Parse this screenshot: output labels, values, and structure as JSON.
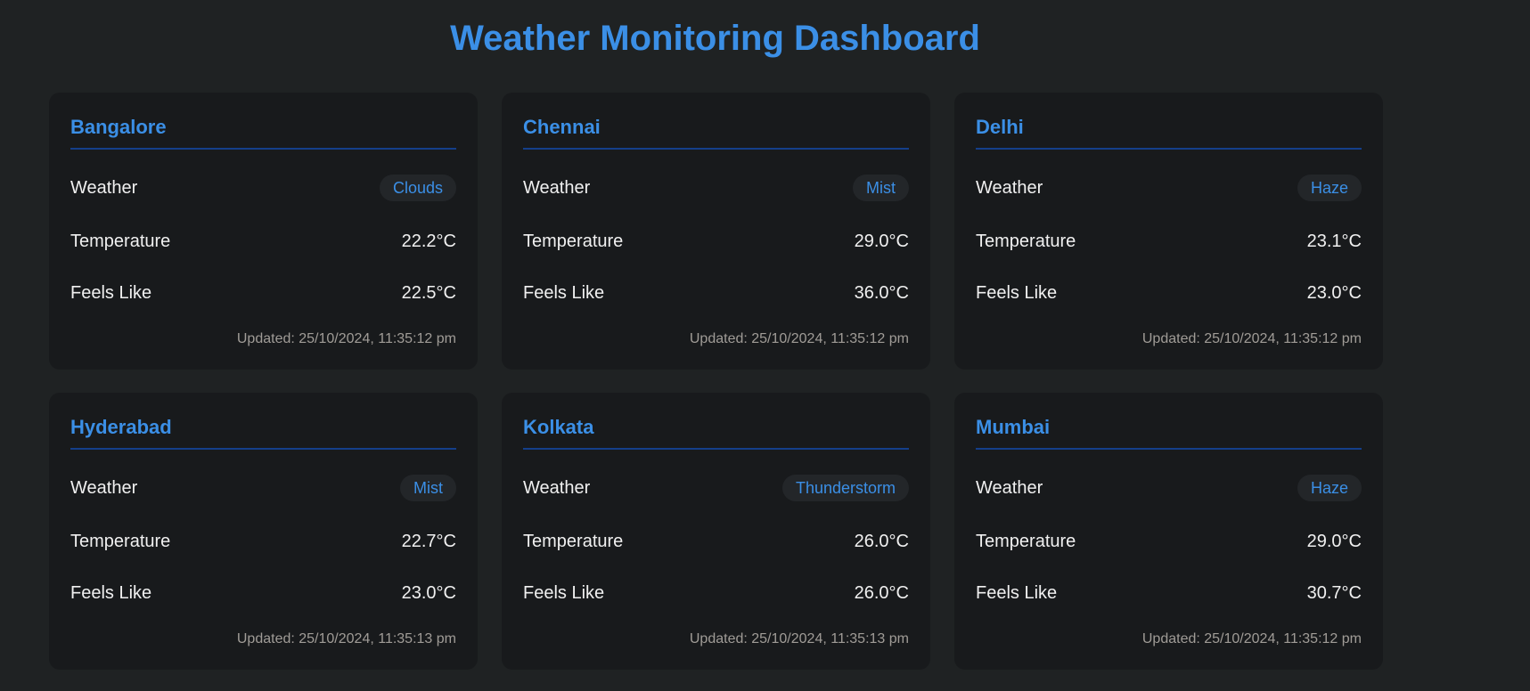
{
  "page": {
    "title": "Weather Monitoring Dashboard"
  },
  "labels": {
    "weather": "Weather",
    "temperature": "Temperature",
    "feels_like": "Feels Like"
  },
  "colors": {
    "background": "#1f2223",
    "card": "#181a1c",
    "accent": "#3b8fe6",
    "divider": "#143f8a"
  },
  "cities": [
    {
      "name": "Bangalore",
      "weather": "Clouds",
      "temperature": "22.2°C",
      "feels_like": "22.5°C",
      "updated": "Updated: 25/10/2024, 11:35:12 pm"
    },
    {
      "name": "Chennai",
      "weather": "Mist",
      "temperature": "29.0°C",
      "feels_like": "36.0°C",
      "updated": "Updated: 25/10/2024, 11:35:12 pm"
    },
    {
      "name": "Delhi",
      "weather": "Haze",
      "temperature": "23.1°C",
      "feels_like": "23.0°C",
      "updated": "Updated: 25/10/2024, 11:35:12 pm"
    },
    {
      "name": "Hyderabad",
      "weather": "Mist",
      "temperature": "22.7°C",
      "feels_like": "23.0°C",
      "updated": "Updated: 25/10/2024, 11:35:13 pm"
    },
    {
      "name": "Kolkata",
      "weather": "Thunderstorm",
      "temperature": "26.0°C",
      "feels_like": "26.0°C",
      "updated": "Updated: 25/10/2024, 11:35:13 pm"
    },
    {
      "name": "Mumbai",
      "weather": "Haze",
      "temperature": "29.0°C",
      "feels_like": "30.7°C",
      "updated": "Updated: 25/10/2024, 11:35:12 pm"
    }
  ]
}
